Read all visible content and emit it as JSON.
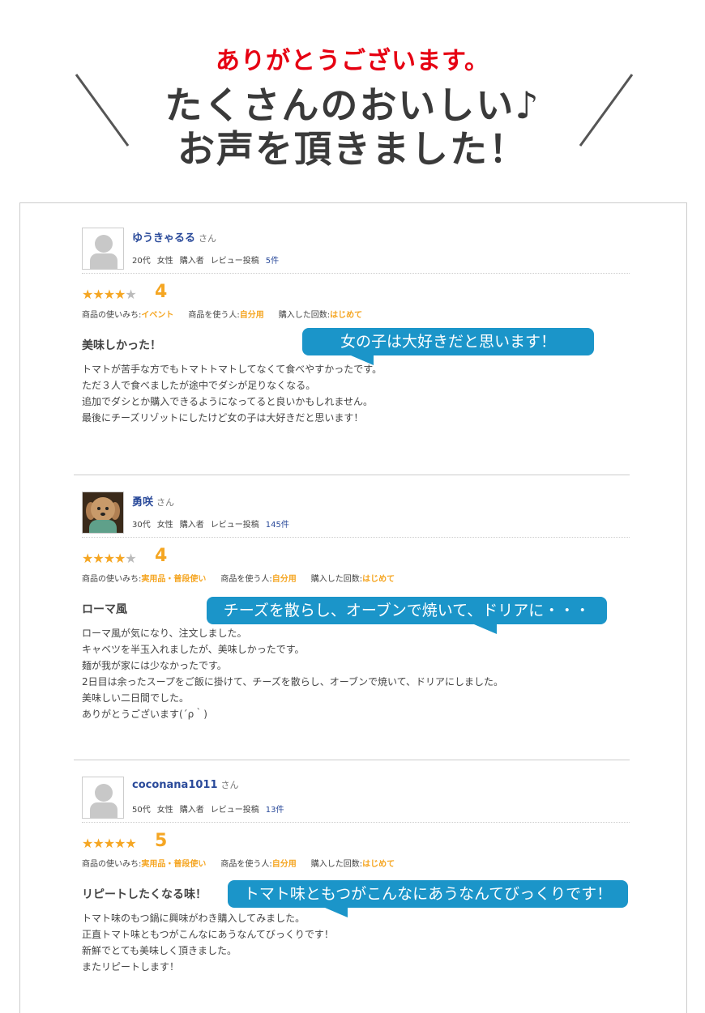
{
  "header": {
    "thanks": "ありがとうございます。",
    "line1": "たくさんのおいしい♪",
    "line2": "お声を頂きました！"
  },
  "reviews": [
    {
      "name": "ゆうきゃるる",
      "honorific": "さん",
      "age": "20代",
      "gender": "女性",
      "buyer": "購入者",
      "posts_label": "レビュー投稿",
      "posts_count": "5件",
      "stars": 4,
      "score": "4",
      "usage_label": "商品の使いみち:",
      "usage": "イベント",
      "user_label": "商品を使う人:",
      "user": "自分用",
      "times_label": "購入した回数:",
      "times": "はじめて",
      "title": "美味しかった！",
      "body": [
        "トマトが苦手な方でもトマトトマトしてなくて食べやすかったです。",
        "ただ３人で食べましたが途中でダシが足りなくなる。",
        "追加でダシとか購入できるようになってると良いかもしれません。",
        "最後にチーズリゾットにしたけど女の子は大好きだと思います！"
      ],
      "bubble": "女の子は大好きだと思います！"
    },
    {
      "name": "勇咲",
      "honorific": "さん",
      "age": "30代",
      "gender": "女性",
      "buyer": "購入者",
      "posts_label": "レビュー投稿",
      "posts_count": "145件",
      "stars": 4,
      "score": "4",
      "usage_label": "商品の使いみち:",
      "usage": "実用品・普段使い",
      "user_label": "商品を使う人:",
      "user": "自分用",
      "times_label": "購入した回数:",
      "times": "はじめて",
      "title": "ローマ風",
      "body": [
        "ローマ風が気になり、注文しました。",
        "キャベツを半玉入れましたが、美味しかったです。",
        "麺が我が家には少なかったです。",
        "2日目は余ったスープをご飯に掛けて、チーズを散らし、オーブンで焼いて、ドリアにしました。",
        "美味しい二日間でした。",
        "ありがとうございます(´ρ｀)"
      ],
      "bubble": "チーズを散らし、オーブンで焼いて、ドリアに・・・"
    },
    {
      "name": "coconana1011",
      "honorific": "さん",
      "age": "50代",
      "gender": "女性",
      "buyer": "購入者",
      "posts_label": "レビュー投稿",
      "posts_count": "13件",
      "stars": 5,
      "score": "5",
      "usage_label": "商品の使いみち:",
      "usage": "実用品・普段使い",
      "user_label": "商品を使う人:",
      "user": "自分用",
      "times_label": "購入した回数:",
      "times": "はじめて",
      "title": "リピートしたくなる味！",
      "body": [
        "トマト味のもつ鍋に興味がわき購入してみました。",
        "正直トマト味ともつがこんなにあうなんてびっくりです！",
        "新鮮でとても美味しく頂きました。",
        "またリピートします！"
      ],
      "bubble": "トマト味ともつがこんなにあうなんてびっくりです！"
    }
  ],
  "colors": {
    "accent_red": "#e60012",
    "star_orange": "#f5a623",
    "bubble_blue": "#1b95c9",
    "name_blue": "#2a4a9a"
  }
}
